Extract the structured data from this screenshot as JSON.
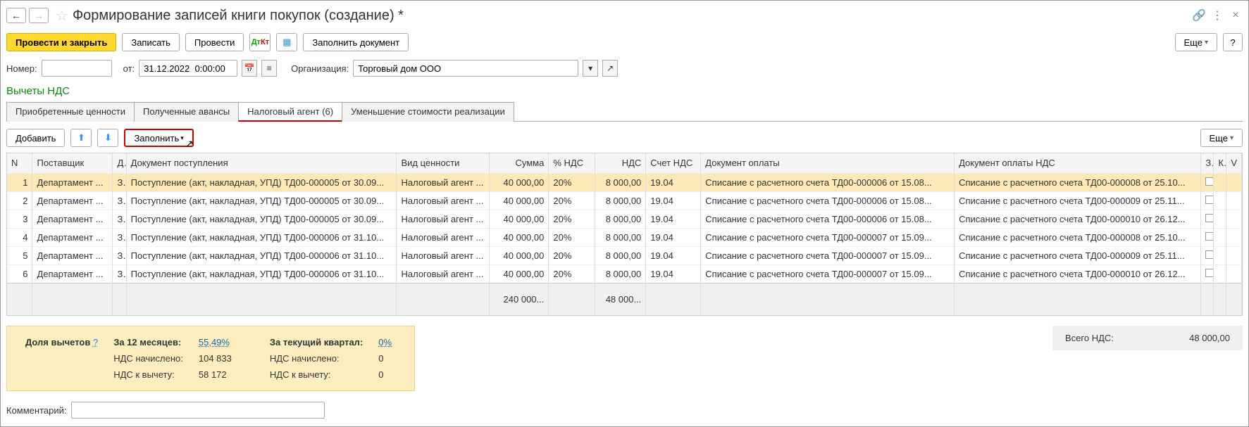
{
  "header": {
    "title": "Формирование записей книги покупок (создание) *"
  },
  "toolbar": {
    "post_close": "Провести и закрыть",
    "write": "Записать",
    "post": "Провести",
    "fill_doc": "Заполнить документ",
    "more": "Еще",
    "help": "?"
  },
  "fields": {
    "number_label": "Номер:",
    "from_label": "от:",
    "date_value": "31.12.2022  0:00:00",
    "org_label": "Организация:",
    "org_value": "Торговый дом ООО"
  },
  "green_heading": "Вычеты НДС",
  "tabs": {
    "t1": "Приобретенные ценности",
    "t2": "Полученные авансы",
    "t3": "Налоговый агент (6)",
    "t4": "Уменьшение стоимости реализации"
  },
  "subtoolbar": {
    "add": "Добавить",
    "fill": "Заполнить",
    "more": "Еще"
  },
  "columns": {
    "n": "N",
    "supplier": "Поставщик",
    "d": "Д",
    "doc": "Документ поступления",
    "vid": "Вид ценности",
    "sum": "Сумма",
    "pnds": "% НДС",
    "nds": "НДС",
    "sch": "Счет НДС",
    "opay": "Документ оплаты",
    "opaynds": "Документ оплаты НДС",
    "x": "З",
    "y": "К",
    "z": "V"
  },
  "rows": [
    {
      "n": "1",
      "supplier": "Департамент ...",
      "d": "З",
      "doc": "Поступление (акт, накладная, УПД) ТД00-000005 от 30.09...",
      "vid": "Налоговый агент ...",
      "sum": "40 000,00",
      "pnds": "20%",
      "nds": "8 000,00",
      "sch": "19.04",
      "opay": "Списание с расчетного счета ТД00-000006 от 15.08...",
      "opaynds": "Списание с расчетного счета ТД00-000008 от 25.10..."
    },
    {
      "n": "2",
      "supplier": "Департамент ...",
      "d": "З",
      "doc": "Поступление (акт, накладная, УПД) ТД00-000005 от 30.09...",
      "vid": "Налоговый агент ...",
      "sum": "40 000,00",
      "pnds": "20%",
      "nds": "8 000,00",
      "sch": "19.04",
      "opay": "Списание с расчетного счета ТД00-000006 от 15.08...",
      "opaynds": "Списание с расчетного счета ТД00-000009 от 25.11..."
    },
    {
      "n": "3",
      "supplier": "Департамент ...",
      "d": "З",
      "doc": "Поступление (акт, накладная, УПД) ТД00-000005 от 30.09...",
      "vid": "Налоговый агент ...",
      "sum": "40 000,00",
      "pnds": "20%",
      "nds": "8 000,00",
      "sch": "19.04",
      "opay": "Списание с расчетного счета ТД00-000006 от 15.08...",
      "opaynds": "Списание с расчетного счета ТД00-000010 от 26.12..."
    },
    {
      "n": "4",
      "supplier": "Департамент ...",
      "d": "З",
      "doc": "Поступление (акт, накладная, УПД) ТД00-000006 от 31.10...",
      "vid": "Налоговый агент ...",
      "sum": "40 000,00",
      "pnds": "20%",
      "nds": "8 000,00",
      "sch": "19.04",
      "opay": "Списание с расчетного счета ТД00-000007 от 15.09...",
      "opaynds": "Списание с расчетного счета ТД00-000008 от 25.10..."
    },
    {
      "n": "5",
      "supplier": "Департамент ...",
      "d": "З",
      "doc": "Поступление (акт, накладная, УПД) ТД00-000006 от 31.10...",
      "vid": "Налоговый агент ...",
      "sum": "40 000,00",
      "pnds": "20%",
      "nds": "8 000,00",
      "sch": "19.04",
      "opay": "Списание с расчетного счета ТД00-000007 от 15.09...",
      "opaynds": "Списание с расчетного счета ТД00-000009 от 25.11..."
    },
    {
      "n": "6",
      "supplier": "Департамент ...",
      "d": "З",
      "doc": "Поступление (акт, накладная, УПД) ТД00-000006 от 31.10...",
      "vid": "Налоговый агент ...",
      "sum": "40 000,00",
      "pnds": "20%",
      "nds": "8 000,00",
      "sch": "19.04",
      "opay": "Списание с расчетного счета ТД00-000007 от 15.09...",
      "opaynds": "Списание с расчетного счета ТД00-000010 от 26.12..."
    }
  ],
  "footer": {
    "sum": "240 000...",
    "nds": "48 000..."
  },
  "summary": {
    "line1_label": "Доля вычетов",
    "q": "?",
    "period": "За 12 месяцев:",
    "pct": "55,49%",
    "curq": "За текущий квартал:",
    "curq_pct": "0%",
    "nds_charged_l": "НДС начислено:",
    "nds_charged_v": "104 833",
    "nds_charged_cur": "НДС начислено:",
    "nds_charged_cur_v": "0",
    "nds_ded_l": "НДС к вычету:",
    "nds_ded_v": "58 172",
    "nds_ded_cur": "НДС к вычету:",
    "nds_ded_cur_v": "0"
  },
  "total": {
    "label": "Всего НДС:",
    "value": "48 000,00"
  },
  "comment": {
    "label": "Комментарий:"
  }
}
